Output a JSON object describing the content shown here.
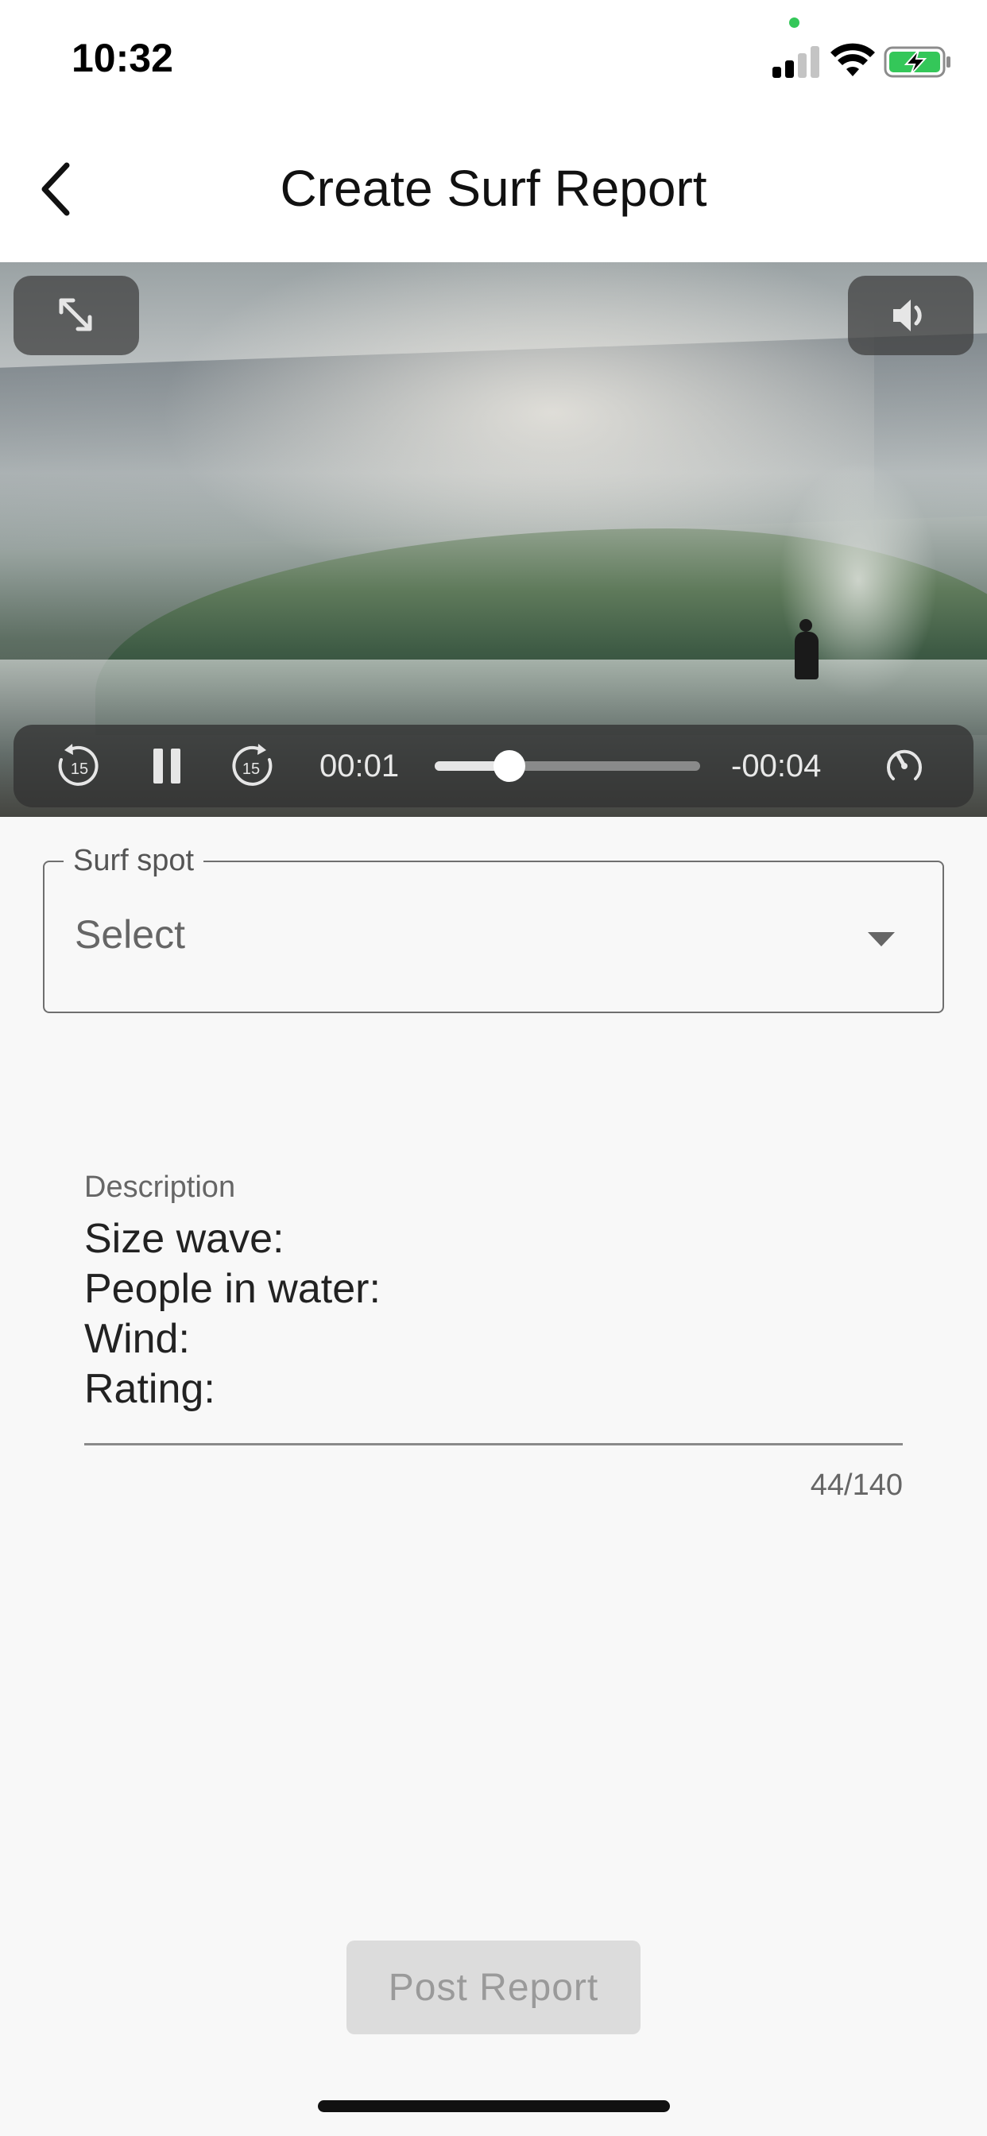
{
  "status_bar": {
    "time": "10:32",
    "signal_bars_active": 2,
    "battery_charging": true,
    "colors": {
      "privacy_dot": "#34c759",
      "battery": "#34c759"
    }
  },
  "header": {
    "title": "Create Surf Report",
    "back_icon": "chevron-left-icon"
  },
  "video": {
    "expand_icon": "expand-icon",
    "volume_icon": "volume-icon",
    "controls": {
      "rewind_icon": "rewind-15-icon",
      "rewind_label": "15",
      "pause_icon": "pause-icon",
      "forward_icon": "forward-15-icon",
      "forward_label": "15",
      "current_time": "00:01",
      "remaining_time": "-00:04",
      "progress": 0.28,
      "speed_icon": "playback-speed-icon"
    }
  },
  "form": {
    "surf_spot": {
      "label": "Surf spot",
      "value": "Select",
      "dropdown_icon": "caret-down-icon"
    },
    "description": {
      "label": "Description",
      "value": "Size wave:\nPeople in water:\nWind:\nRating:",
      "counter": "44/140"
    },
    "submit_label": "Post Report"
  }
}
